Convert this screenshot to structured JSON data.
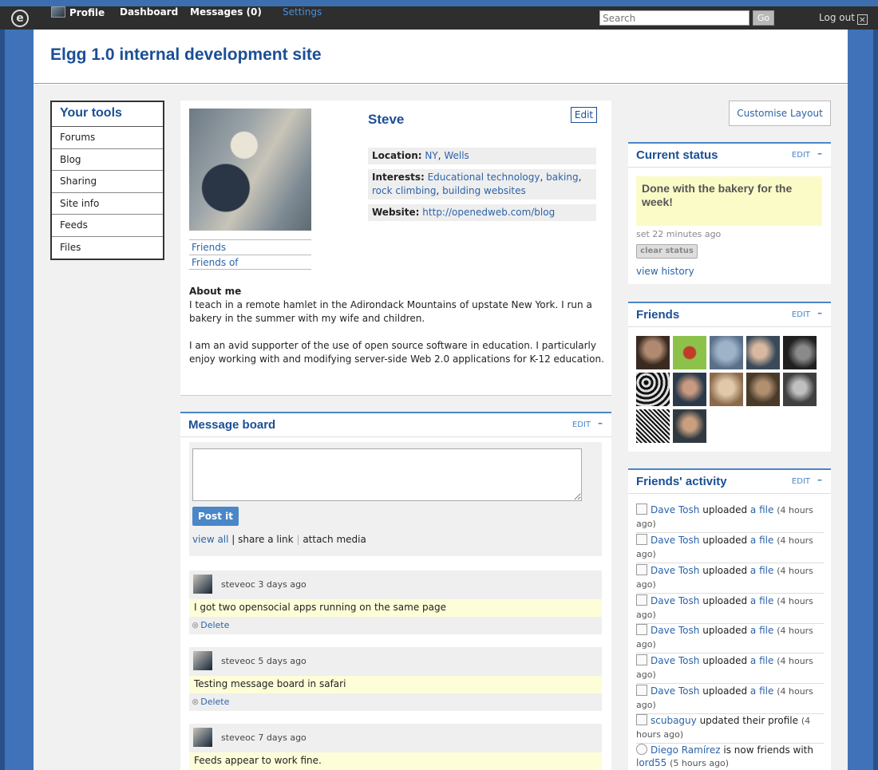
{
  "topbar": {
    "logo": "e",
    "nav": [
      {
        "label": "Profile",
        "active": false
      },
      {
        "label": "Dashboard",
        "active": false
      },
      {
        "label": "Messages (0)",
        "active": false
      },
      {
        "label": "Settings",
        "active": true
      }
    ],
    "search_placeholder": "Search",
    "go_label": "Go",
    "logout_label": "Log out",
    "logout_icon": "close-x-icon"
  },
  "site": {
    "title": "Elgg 1.0 internal development site"
  },
  "tools": {
    "title": "Your tools",
    "items": [
      "Forums",
      "Blog",
      "Sharing",
      "Site info",
      "Feeds",
      "Files"
    ]
  },
  "profile": {
    "name": "Steve",
    "edit_label": "Edit",
    "links": [
      "Friends",
      "Friends of"
    ],
    "location_label": "Location:",
    "location": [
      "NY",
      "Wells"
    ],
    "interests_label": "Interests:",
    "interests": [
      "Educational technology",
      "baking",
      "rock climbing",
      "building websites"
    ],
    "website_label": "Website:",
    "website": "http://openedweb.com/blog",
    "about_heading": "About me",
    "about": [
      "I teach in a remote hamlet in the Adirondack Mountains of upstate New York. I run a bakery in the summer with my wife and children.",
      "I am an avid supporter of the use of open source software in education. I particularly enjoy working with and modifying server-side Web 2.0 applications for K-12 education."
    ]
  },
  "message_board": {
    "title": "Message board",
    "edit": "EDIT",
    "collapse": "–",
    "post_label": "Post it",
    "links": [
      "view all",
      "share a link",
      "attach media"
    ],
    "messages": [
      {
        "user": "steveoc",
        "time": "3 days ago",
        "text": "I got two opensocial apps running on the same page",
        "delete": "Delete"
      },
      {
        "user": "steveoc",
        "time": "5 days ago",
        "text": "Testing message board in safari",
        "delete": "Delete"
      },
      {
        "user": "steveoc",
        "time": "7 days ago",
        "text": "Feeds appear to work fine.",
        "delete": "Delete"
      }
    ]
  },
  "customise_label": "Customise Layout",
  "status": {
    "title": "Current status",
    "edit": "EDIT",
    "collapse": "–",
    "text": "Done with the bakery for the week!",
    "time": "set 22 minutes ago",
    "clear": "clear status",
    "history": "view history"
  },
  "friends": {
    "title": "Friends",
    "edit": "EDIT",
    "collapse": "–",
    "count": 12
  },
  "activity": {
    "title": "Friends' activity",
    "edit": "EDIT",
    "collapse": "–",
    "items": [
      {
        "icon": "file-icon",
        "who": "Dave Tosh",
        "action": "uploaded",
        "object": "a file",
        "time": "(4 hours ago)"
      },
      {
        "icon": "file-icon",
        "who": "Dave Tosh",
        "action": "uploaded",
        "object": "a file",
        "time": "(4 hours ago)"
      },
      {
        "icon": "file-icon",
        "who": "Dave Tosh",
        "action": "uploaded",
        "object": "a file",
        "time": "(4 hours ago)"
      },
      {
        "icon": "file-icon",
        "who": "Dave Tosh",
        "action": "uploaded",
        "object": "a file",
        "time": "(4 hours ago)"
      },
      {
        "icon": "file-icon",
        "who": "Dave Tosh",
        "action": "uploaded",
        "object": "a file",
        "time": "(4 hours ago)"
      },
      {
        "icon": "file-icon",
        "who": "Dave Tosh",
        "action": "uploaded",
        "object": "a file",
        "time": "(4 hours ago)"
      },
      {
        "icon": "file-icon",
        "who": "Dave Tosh",
        "action": "uploaded",
        "object": "a file",
        "time": "(4 hours ago)"
      },
      {
        "icon": "user-icon",
        "who": "scubaguy",
        "action": "updated their profile",
        "object": "",
        "time": "(4 hours ago)"
      },
      {
        "icon": "friend-icon",
        "who": "Diego Ramírez",
        "action": "is now friends with",
        "object": "lord55",
        "time": "(5 hours ago)"
      }
    ]
  },
  "colors": {
    "brand": "#1a4f95",
    "accent": "#4a86c8",
    "highlight": "#fdfdd8"
  }
}
